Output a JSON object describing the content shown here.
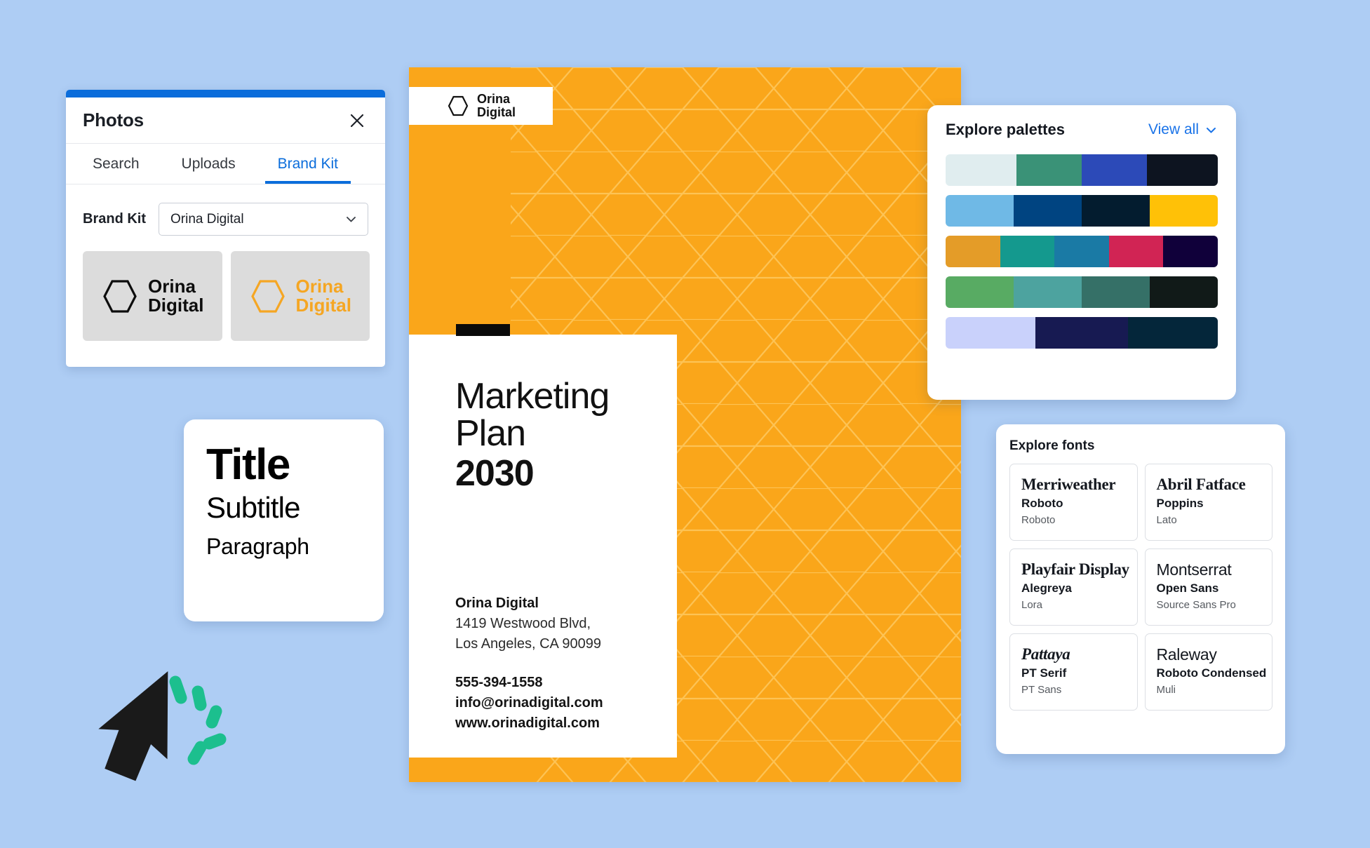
{
  "colors": {
    "background": "#aecdf4",
    "accent_blue": "#0b6ddb",
    "brand_orange": "#faa61a",
    "logo_orange": "#f5a623",
    "cursor_black": "#1a1a1a",
    "click_green": "#1cbf8e"
  },
  "photos_panel": {
    "title": "Photos",
    "close_icon": "close-icon",
    "tabs": [
      {
        "label": "Search",
        "active": false
      },
      {
        "label": "Uploads",
        "active": false
      },
      {
        "label": "Brand Kit",
        "active": true
      }
    ],
    "brand_kit_label": "Brand Kit",
    "brand_kit_select": {
      "value": "Orina Digital",
      "chevron_icon": "chevron-down-icon"
    },
    "logos": [
      {
        "icon": "hexagon-icon",
        "line1": "Orina",
        "line2": "Digital",
        "variant": "dark"
      },
      {
        "icon": "hexagon-icon",
        "line1": "Orina",
        "line2": "Digital",
        "variant": "orange"
      }
    ]
  },
  "type_card": {
    "title": "Title",
    "subtitle": "Subtitle",
    "paragraph": "Paragraph"
  },
  "cursor": {
    "icon": "cursor-click-icon"
  },
  "document": {
    "badge": {
      "icon": "hexagon-icon",
      "line1": "Orina",
      "line2": "Digital"
    },
    "heading_line1": "Marketing",
    "heading_line2": "Plan",
    "year": "2030",
    "company": "Orina Digital",
    "address_line1": "1419 Westwood Blvd,",
    "address_line2": "Los Angeles, CA 90099",
    "phone": "555-394-1558",
    "email": "info@orinadigital.com",
    "website": "www.orinadigital.com"
  },
  "palettes_panel": {
    "title": "Explore palettes",
    "view_all_label": "View all",
    "view_all_icon": "chevron-down-icon",
    "palettes": [
      {
        "swatches": [
          "#e0edef",
          "#3a9277",
          "#2c4ab8",
          "#0d1420"
        ],
        "widths": [
          26,
          24,
          24,
          26
        ]
      },
      {
        "swatches": [
          "#6fb9e6",
          "#004481",
          "#031c2f",
          "#ffc107"
        ],
        "widths": [
          25,
          25,
          25,
          25
        ]
      },
      {
        "swatches": [
          "#e49c28",
          "#14998e",
          "#1a7aa5",
          "#d12454",
          "#10003a"
        ],
        "widths": [
          20,
          20,
          20,
          20,
          20
        ]
      },
      {
        "swatches": [
          "#58ab63",
          "#4da39f",
          "#357067",
          "#111a18"
        ],
        "widths": [
          25,
          25,
          25,
          25
        ]
      },
      {
        "swatches": [
          "#c9d1fb",
          "#171a52",
          "#04263a"
        ],
        "widths": [
          33,
          34,
          33
        ]
      }
    ]
  },
  "fonts_panel": {
    "title": "Explore fonts",
    "fonts": [
      {
        "heading": "Merriweather",
        "sub": "Roboto",
        "body": "Roboto",
        "style": "serif"
      },
      {
        "heading": "Abril Fatface",
        "sub": "Poppins",
        "body": "Lato",
        "style": "serif"
      },
      {
        "heading": "Playfair Display",
        "sub": "Alegreya",
        "body": "Lora",
        "style": "serif"
      },
      {
        "heading": "Montserrat",
        "sub": "Open Sans",
        "body": "Source Sans Pro",
        "style": "sans"
      },
      {
        "heading": "Pattaya",
        "sub": "PT Serif",
        "body": "PT Sans",
        "style": "italic"
      },
      {
        "heading": "Raleway",
        "sub": "Roboto Condensed",
        "body": "Muli",
        "style": "sans"
      }
    ]
  }
}
